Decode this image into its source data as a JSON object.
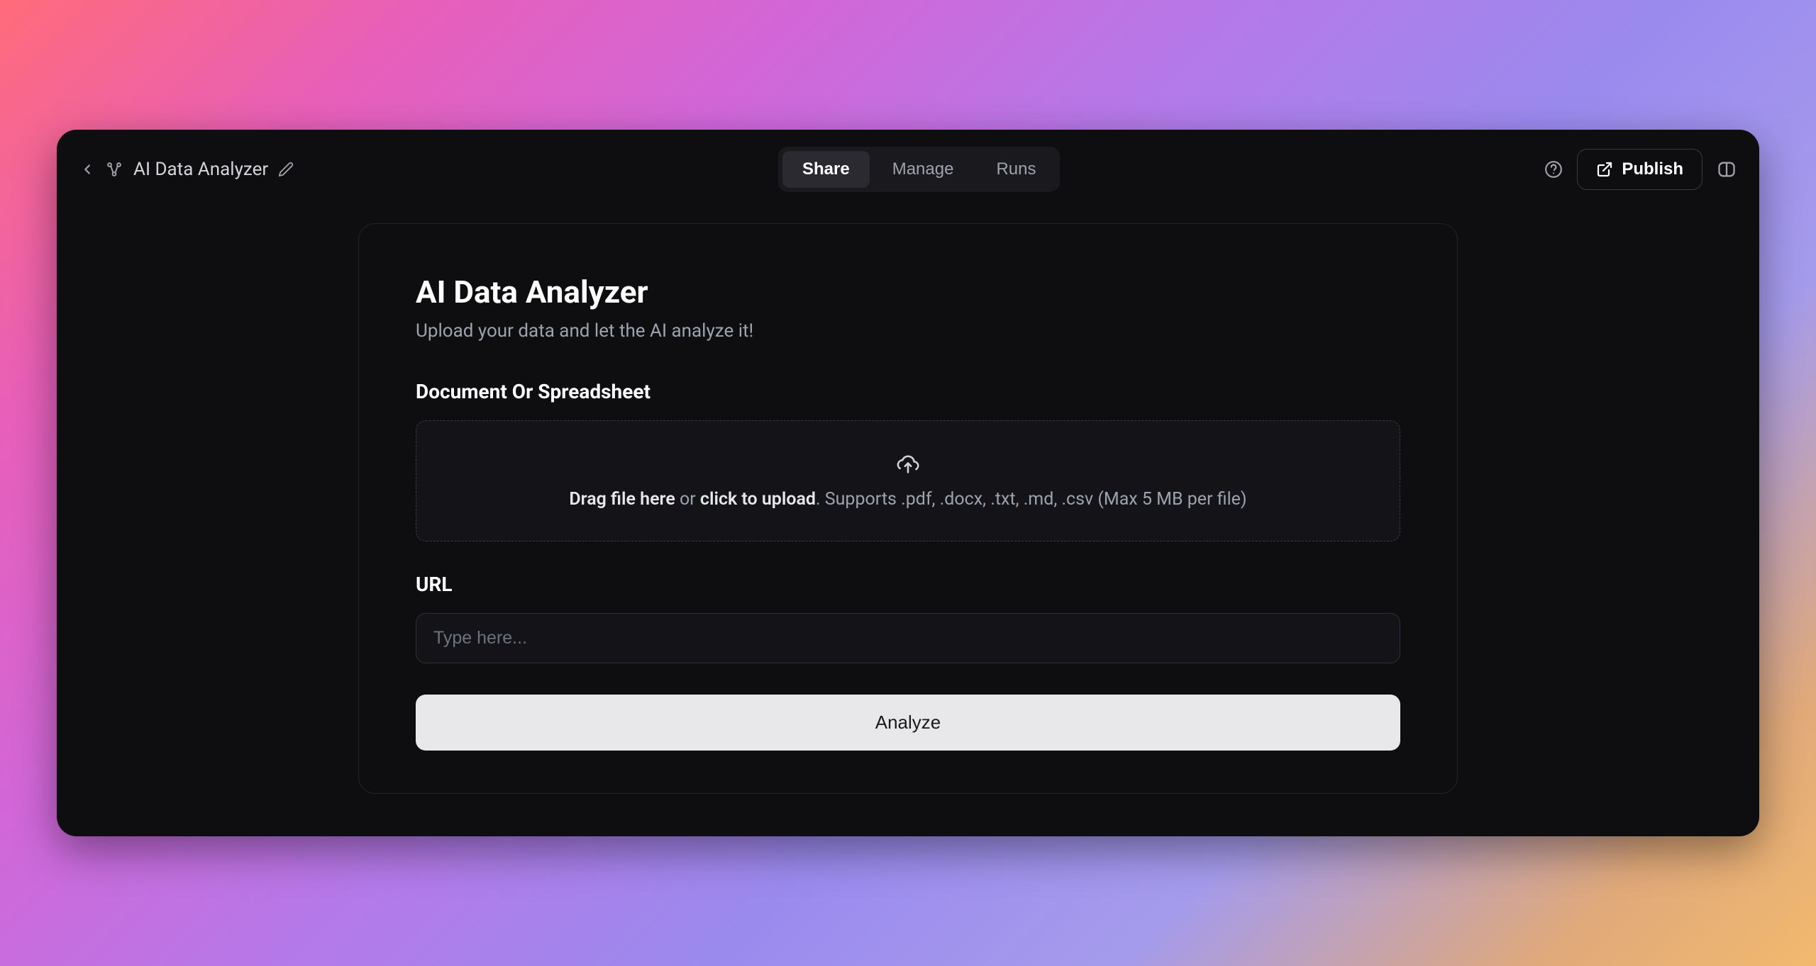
{
  "header": {
    "app_title": "AI Data Analyzer",
    "tabs": [
      {
        "label": "Share",
        "active": true
      },
      {
        "label": "Manage",
        "active": false
      },
      {
        "label": "Runs",
        "active": false
      }
    ],
    "publish_label": "Publish"
  },
  "main": {
    "title": "AI Data Analyzer",
    "subtitle": "Upload your data and let the AI analyze it!",
    "document_section_label": "Document Or Spreadsheet",
    "dropzone": {
      "drag_text": "Drag file here",
      "or_text": " or ",
      "click_text": "click to upload",
      "supports_text": ". Supports .pdf, .docx, .txt, .md, .csv (Max 5 MB per file)"
    },
    "url_section_label": "URL",
    "url_placeholder": "Type here...",
    "url_value": "",
    "analyze_label": "Analyze"
  }
}
